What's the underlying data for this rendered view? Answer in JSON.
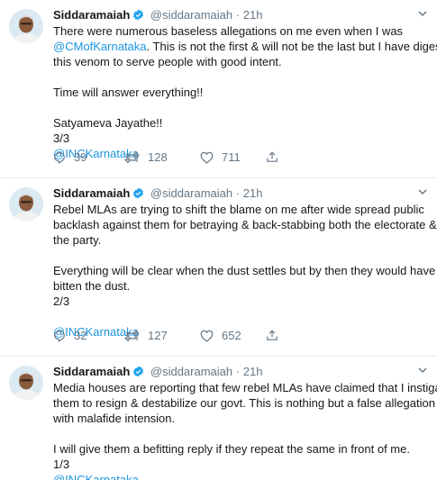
{
  "tweets": [
    {
      "name": "Siddaramaiah",
      "handle": "@siddaramaiah",
      "dot": "·",
      "time": "21h",
      "lines_a": [
        "There were numerous baseless allegations on me even when I was",
        "@CMofKarnataka",
        ". This is not the first & will not be the last but I have digested",
        "this venom to serve people with good intent."
      ],
      "para2": "Time will answer everything!!",
      "para3": "Satyameva Jayathe!!",
      "count": "3/3",
      "mention": "@INCKarnataka",
      "replies": "39",
      "retweets": "128",
      "likes": "711"
    },
    {
      "name": "Siddaramaiah",
      "handle": "@siddaramaiah",
      "dot": "·",
      "time": "21h",
      "lines_a": [
        "Rebel MLAs are trying to shift the blame on me after wide spread public",
        "backlash against them for betraying & back-stabbing both the electorate &",
        "the party."
      ],
      "lines_b": [
        "Everything will be clear when the dust settles but by then they would have",
        "bitten the dust."
      ],
      "count": "2/3",
      "mention": "@INCKarnataka",
      "replies": "32",
      "retweets": "127",
      "likes": "652"
    },
    {
      "name": "Siddaramaiah",
      "handle": "@siddaramaiah",
      "dot": "·",
      "time": "21h",
      "lines_a": [
        "Media houses are reporting that few rebel MLAs have claimed that I instigated",
        "them to resign & destabilize our govt. This is nothing but a false allegation",
        "with malafide intension."
      ],
      "lines_b": [
        "I will give them a befitting reply if they repeat the same in front of me."
      ],
      "count": "1/3",
      "mention": "@INCKarnataka"
    }
  ],
  "icons": {
    "more": "chevron-down-icon",
    "verified": "verified-badge-icon",
    "reply": "reply-icon",
    "retweet": "retweet-icon",
    "like": "like-icon",
    "share": "share-icon"
  },
  "colors": {
    "link": "#1b95e0",
    "verified": "#1da1f2",
    "muted": "#657786",
    "divider": "#e6ecf0"
  }
}
